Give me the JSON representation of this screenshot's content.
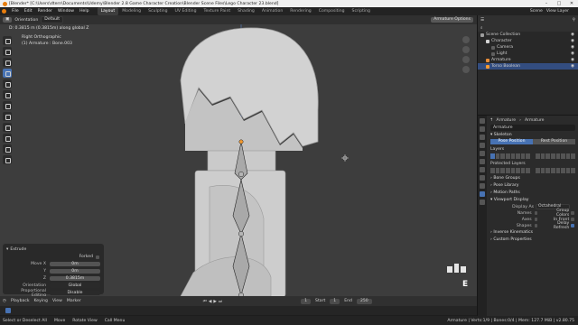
{
  "window": {
    "title": "[Blender* [C:\\Users\\dtern\\Documents\\Udemy\\Blender 2.8 Game Character Creation\\Blender Scene Files\\Lego Character 23.blend]"
  },
  "menu": {
    "items": [
      "File",
      "Edit",
      "Render",
      "Window",
      "Help"
    ],
    "workspaces": [
      "Layout",
      "Modeling",
      "Sculpting",
      "UV Editing",
      "Texture Paint",
      "Shading",
      "Animation",
      "Rendering",
      "Compositing",
      "Scripting"
    ],
    "active_workspace": "Layout",
    "scene_label": "Scene",
    "view_layer_label": "View Layer"
  },
  "viewport_header": {
    "mode": "Orientation",
    "orientation": "Default",
    "options_label": "Armature Options"
  },
  "viewport": {
    "transform_readout": "D: 0.3815 m (0.3815m) along global Z",
    "view_name": "Right Orthographic",
    "object_label": "(1) Armature : Bone.003",
    "axis_letter": "E"
  },
  "extrude_panel": {
    "title": "Extrude",
    "forked_label": "Forked",
    "rows": [
      {
        "label": "Move X",
        "value": "0m"
      },
      {
        "label": "Y",
        "value": "0m"
      },
      {
        "label": "Z",
        "value": "0.3815m"
      }
    ],
    "orientation_label": "Orientation",
    "orientation_value": "Global",
    "prop_edit_label": "Proportional Editing",
    "prop_edit_value": "Disable"
  },
  "timeline": {
    "items": [
      "Playback",
      "Keying",
      "View",
      "Marker"
    ],
    "current_frame": "1",
    "start_label": "Start",
    "start": "1",
    "end_label": "End",
    "end": "250"
  },
  "statusbar": {
    "items": [
      "Select or Deselect All",
      "Move",
      "Rotate View",
      "Call Menu"
    ],
    "stats": "Armature | Verts:1/9 | Bones:0/4 | Mem: 127.7 MiB | v2.80.75"
  },
  "outliner": {
    "rows": [
      {
        "label": "Scene Collection",
        "indent": 0,
        "color": "#9e9e9e",
        "selected": false
      },
      {
        "label": "Character",
        "indent": 1,
        "color": "#d3d3d3",
        "selected": false
      },
      {
        "label": "Camera",
        "indent": 2,
        "color": "#5f5f5f",
        "selected": false
      },
      {
        "label": "Light",
        "indent": 2,
        "color": "#5f5f5f",
        "selected": false
      },
      {
        "label": "Armature",
        "indent": 1,
        "color": "#e88d3a",
        "selected": false
      },
      {
        "label": "Torso Boolean",
        "indent": 1,
        "color": "#ff9b30",
        "selected": true
      }
    ]
  },
  "properties": {
    "object_name": "Armature",
    "data_name": "Armature",
    "skeleton_heading": "Skeleton",
    "pose_position": "Pose Position",
    "rest_position": "Rest Position",
    "layers_heading": "Layers",
    "protected_layers_heading": "Protected Layers",
    "panels": [
      "Bone Groups",
      "Pose Library",
      "Motion Paths",
      "Viewport Display"
    ],
    "display_as_label": "Display As",
    "display_as_value": "Octahedral",
    "options": [
      {
        "label": "Names",
        "right_label": "Group Colors"
      },
      {
        "label": "Axes",
        "right_label": "In Front"
      },
      {
        "label": "Shapes",
        "right_label": "Delay Refresh"
      }
    ],
    "footer_panels": [
      "Inverse Kinematics",
      "Custom Properties"
    ]
  }
}
